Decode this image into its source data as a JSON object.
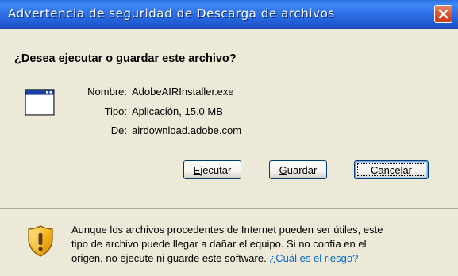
{
  "window": {
    "title": "Advertencia de seguridad de Descarga de archivos"
  },
  "dialog": {
    "question": "¿Desea ejecutar o guardar este archivo?",
    "file": {
      "icon": "application-window-icon",
      "name_label": "Nombre:",
      "name_value": "AdobeAIRInstaller.exe",
      "type_label": "Tipo:",
      "type_value": "Aplicación, 15.0 MB",
      "from_label": "De:",
      "from_value": "airdownload.adobe.com"
    },
    "buttons": {
      "run": "Ejecutar",
      "save": "Guardar",
      "cancel": "Cancelar"
    },
    "warning": {
      "icon": "security-shield-icon",
      "line1": "Aunque los archivos procedentes de Internet pueden ser útiles, este",
      "line2": "tipo de archivo puede llegar a dañar el equipo. Si no confía en el",
      "line3": "origen, no ejecute ni guarde este software.",
      "link": "¿Cuál es el riesgo?"
    }
  },
  "colors": {
    "titlebar": "#2561d8",
    "background": "#ece9d8",
    "link": "#0066cc",
    "close_button": "#dc5b35"
  }
}
